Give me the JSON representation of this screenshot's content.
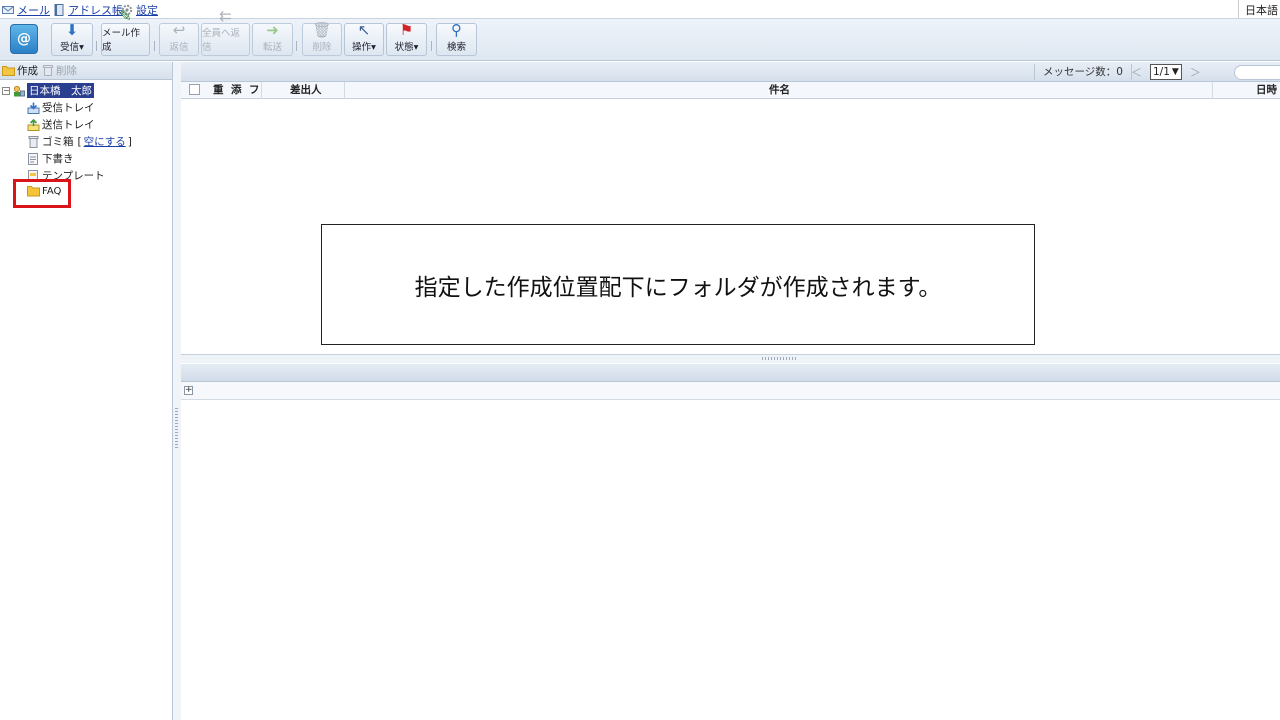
{
  "topbar": {
    "mail": "メール",
    "address": "アドレス帳",
    "settings": "設定",
    "lang": "日本語"
  },
  "toolbar": {
    "mail_icon": "@",
    "receive": "受信▾",
    "compose": "メール作成",
    "reply": "返信",
    "reply_all": "全員へ返信",
    "forward": "転送",
    "delete": "削除",
    "operation": "操作▾",
    "status": "状態▾",
    "search": "検索"
  },
  "leftpane": {
    "create": "作成",
    "delete": "削除",
    "account": "日本橋　太郎",
    "folders": {
      "inbox": "受信トレイ",
      "sent": "送信トレイ",
      "trash": "ゴミ箱",
      "empty_open": "[",
      "empty": "空にする",
      "empty_close": "]",
      "drafts": "下書き",
      "templates": "テンプレート",
      "faq": "FAQ"
    }
  },
  "list": {
    "message_count": "メッセージ数：0",
    "prev": "＜",
    "page": "1/1",
    "next": "＞",
    "columns": {
      "importance": "重",
      "attachment": "添",
      "flag": "フ",
      "from": "差出人",
      "subject": "件名",
      "date": "日時"
    }
  },
  "callout": {
    "text": "指定した作成位置配下にフォルダが作成されます。"
  },
  "preview": {
    "expand": "+"
  }
}
